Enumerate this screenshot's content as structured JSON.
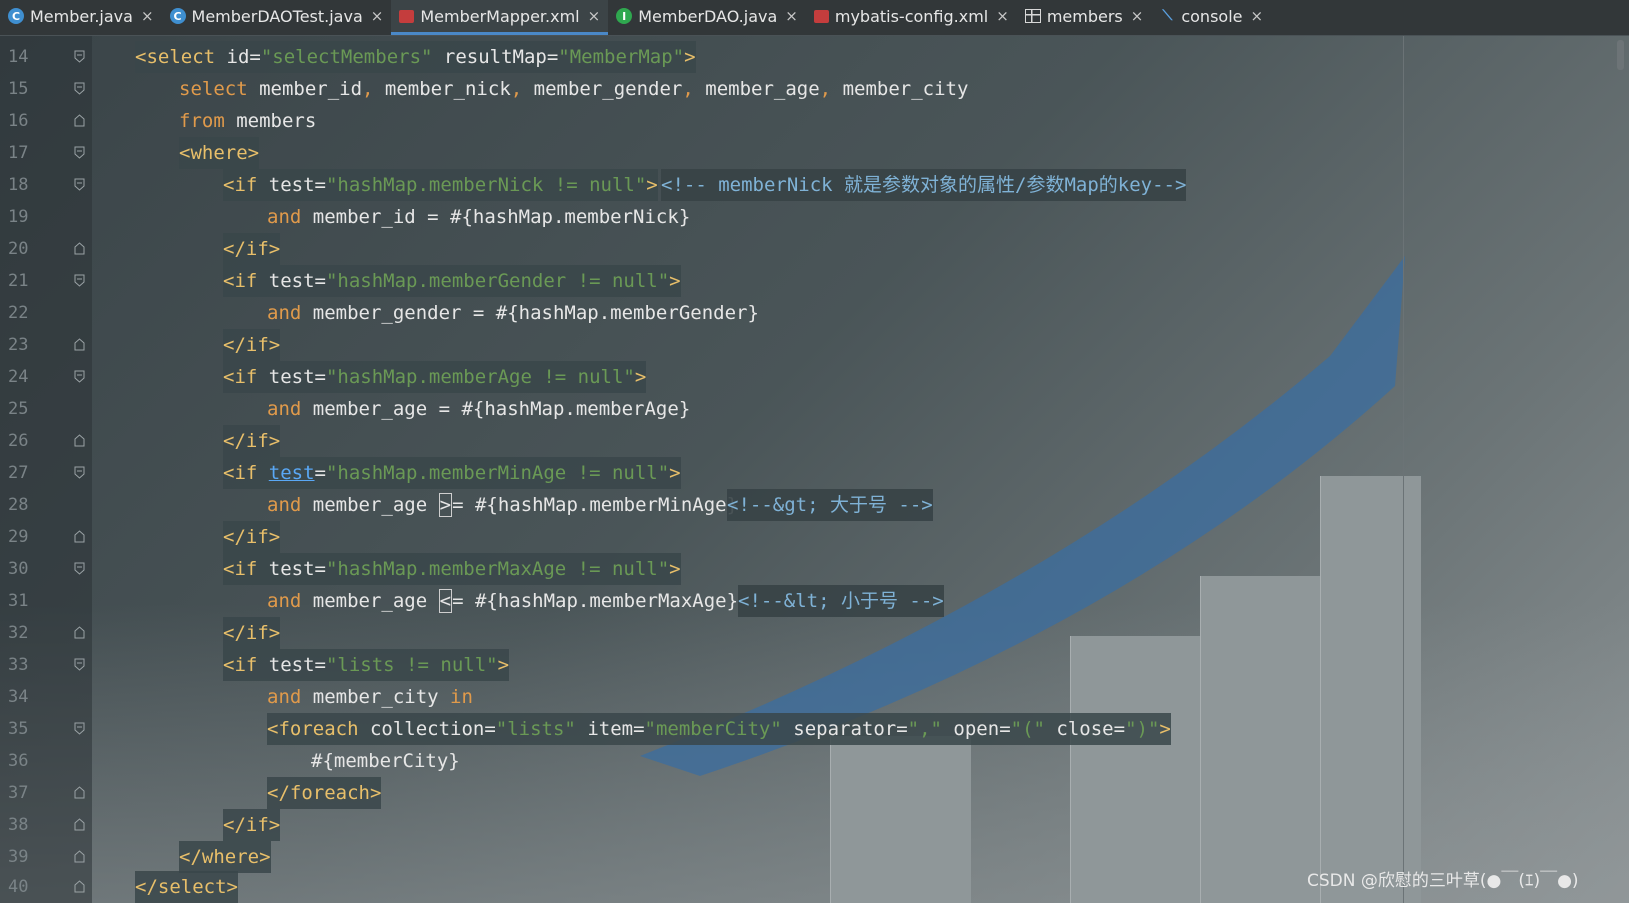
{
  "tabs": [
    {
      "label": "Member.java",
      "icon": "class-c-icon",
      "active": false
    },
    {
      "label": "MemberDAOTest.java",
      "icon": "class-c-icon",
      "active": false
    },
    {
      "label": "MemberMapper.xml",
      "icon": "xml-file-icon",
      "active": true
    },
    {
      "label": "MemberDAO.java",
      "icon": "interface-i-icon",
      "active": false
    },
    {
      "label": "mybatis-config.xml",
      "icon": "xml-file-icon",
      "active": false
    },
    {
      "label": "members",
      "icon": "table-icon",
      "active": false
    },
    {
      "label": "console",
      "icon": "console-icon",
      "active": false
    }
  ],
  "close_glyph": "×",
  "line_numbers": [
    "14",
    "15",
    "16",
    "17",
    "18",
    "19",
    "20",
    "21",
    "22",
    "23",
    "24",
    "25",
    "26",
    "27",
    "28",
    "29",
    "30",
    "31",
    "32",
    "33",
    "34",
    "35",
    "36",
    "37",
    "38",
    "39",
    "40"
  ],
  "code": {
    "l14": {
      "open": "<select ",
      "a1": "id",
      "eq1": "=",
      "v1": "\"selectMembers\"",
      "a2": " resultMap",
      "eq2": "=",
      "v2": "\"MemberMap\"",
      "close": ">"
    },
    "l15": {
      "kw": "select",
      "rest1": " member_id",
      "c1": ",",
      "rest2": " member_nick",
      "c2": ",",
      "rest3": " member_gender",
      "c3": ",",
      "rest4": " member_age",
      "c4": ",",
      "rest5": " member_city"
    },
    "l16": {
      "kw": "from",
      "rest": " members"
    },
    "l17": {
      "tag": "<where>"
    },
    "l18": {
      "open": "<if ",
      "a1": "test",
      "eq1": "=",
      "v1": "\"hashMap.memberNick != null\"",
      "close": ">",
      "comment": "<!-- memberNick 就是参数对象的属性/参数Map的key-->"
    },
    "l19": {
      "kw": "and",
      "rest": " member_id = #{hashMap.memberNick}"
    },
    "l20": {
      "tag": "</if>"
    },
    "l21": {
      "open": "<if ",
      "a1": "test",
      "eq1": "=",
      "v1": "\"hashMap.memberGender != null\"",
      "close": ">"
    },
    "l22": {
      "kw": "and",
      "rest": " member_gender = #{hashMap.memberGender}"
    },
    "l23": {
      "tag": "</if>"
    },
    "l24": {
      "open": "<if ",
      "a1": "test",
      "eq1": "=",
      "v1": "\"hashMap.memberAge != null\"",
      "close": ">"
    },
    "l25": {
      "kw": "and",
      "rest": " member_age = #{hashMap.memberAge}"
    },
    "l26": {
      "tag": "</if>"
    },
    "l27": {
      "open": "<if ",
      "a1": "test",
      "eq1": "=",
      "v1": "\"hashMap.memberMinAge != null\"",
      "close": ">"
    },
    "l28": {
      "kw": "and",
      "rest1": " member_age ",
      "caret": ">",
      "rest2": "= #{hashMap.memberMinAge}",
      "comment": "<!--&gt; 大于号 -->"
    },
    "l29": {
      "tag": "</if>"
    },
    "l30": {
      "open": "<if ",
      "a1": "test",
      "eq1": "=",
      "v1": "\"hashMap.memberMaxAge != null\"",
      "close": ">"
    },
    "l31": {
      "kw": "and",
      "rest1": " member_age ",
      "caret": "<",
      "rest2": "= #{hashMap.memberMaxAge}",
      "comment": "<!--&lt; 小于号 -->"
    },
    "l32": {
      "tag": "</if>"
    },
    "l33": {
      "open": "<if ",
      "a1": "test",
      "eq1": "=",
      "v1": "\"lists != null\"",
      "close": ">"
    },
    "l34": {
      "kw1": "and",
      "rest": " member_city ",
      "kw2": "in"
    },
    "l35": {
      "open": "<foreach ",
      "a1": "collection",
      "eq1": "=",
      "v1": "\"lists\"",
      "a2": " item",
      "eq2": "=",
      "v2": "\"memberCity\"",
      "a3": " separator",
      "eq3": "=",
      "v3": "\",\"",
      "a4": " open",
      "eq4": "=",
      "v4": "\"(\"",
      "a5": " close",
      "eq5": "=",
      "v5": "\")\"",
      "close": ">"
    },
    "l36": {
      "plain": "#{memberCity}"
    },
    "l37": {
      "tag": "</foreach>"
    },
    "l38": {
      "tag": "</if>"
    },
    "l39": {
      "tag": "</where>"
    },
    "l40": {
      "tag": "</select>"
    }
  },
  "watermark": "CSDN @欣慰的三叶草(●￣(ｴ)￣●)",
  "colors": {
    "tag": "#e8bf6a",
    "string": "#6a9955",
    "keyword": "#e09a4b",
    "comment": "#7fb2d6",
    "link": "#5aa8f5",
    "active_tab_underline": "#4a88c7"
  }
}
